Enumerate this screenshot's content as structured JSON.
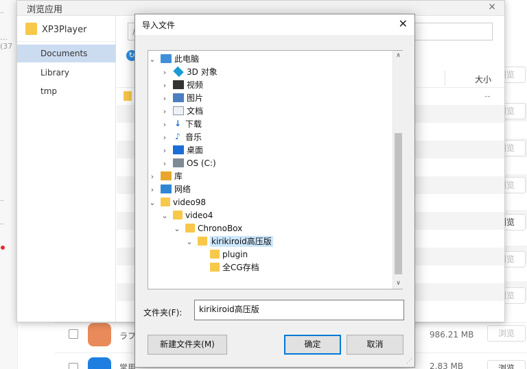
{
  "background": {
    "left_strip_text": "… (37",
    "browse_buttons": [
      "浏览",
      "浏览",
      "浏览",
      "浏览",
      "浏览",
      "浏览",
      "浏览",
      "浏览",
      "浏览"
    ],
    "apps": [
      {
        "name": "ラフ…",
        "size": "986.21 MB",
        "browse": "浏览"
      },
      {
        "name": "常用…",
        "size": "2.83 MB",
        "browse": "浏览"
      }
    ]
  },
  "browse_window": {
    "title": "浏览应用",
    "close": "×",
    "sidebar": {
      "header": "XP3Player",
      "items": [
        "Documents",
        "Library",
        "tmp"
      ],
      "active_index": 0
    },
    "path_placeholder": "/",
    "column_size": "大小",
    "first_row_size": "--"
  },
  "import_dialog": {
    "title": "导入文件",
    "close": "✕",
    "tree": [
      {
        "label": "此电脑",
        "icon": "pc-icon",
        "arrow": "⌄"
      },
      {
        "label": "3D 对象",
        "icon": "cube-icon",
        "arrow": "›"
      },
      {
        "label": "视频",
        "icon": "video-icon",
        "arrow": "›"
      },
      {
        "label": "图片",
        "icon": "picture-icon",
        "arrow": "›"
      },
      {
        "label": "文档",
        "icon": "document-icon",
        "arrow": "›"
      },
      {
        "label": "下载",
        "icon": "download-icon",
        "arrow": "›"
      },
      {
        "label": "音乐",
        "icon": "music-icon",
        "arrow": "›"
      },
      {
        "label": "桌面",
        "icon": "desktop-icon",
        "arrow": "›"
      },
      {
        "label": "OS (C:)",
        "icon": "drive-icon",
        "arrow": "›"
      },
      {
        "label": "库",
        "icon": "library-icon",
        "arrow": "›"
      },
      {
        "label": "网络",
        "icon": "network-icon",
        "arrow": "›"
      },
      {
        "label": "video98",
        "icon": "folder-icon",
        "arrow": "⌄"
      },
      {
        "label": "video4",
        "icon": "folder-icon",
        "arrow": "⌄"
      },
      {
        "label": "ChronoBox",
        "icon": "folder-icon",
        "arrow": "⌄"
      },
      {
        "label": "kirikiroid高压版",
        "icon": "folder-icon",
        "arrow": "⌄",
        "selected": true
      },
      {
        "label": "plugin",
        "icon": "folder-icon",
        "arrow": ""
      },
      {
        "label": "全CG存档",
        "icon": "folder-icon",
        "arrow": ""
      }
    ],
    "scroll_up": "∧",
    "scroll_down": "∨",
    "folder_label": "文件夹(F):",
    "folder_value": "kirikiroid高压版",
    "buttons": {
      "new_folder": "新建文件夹(M)",
      "ok": "确定",
      "cancel": "取消"
    }
  }
}
